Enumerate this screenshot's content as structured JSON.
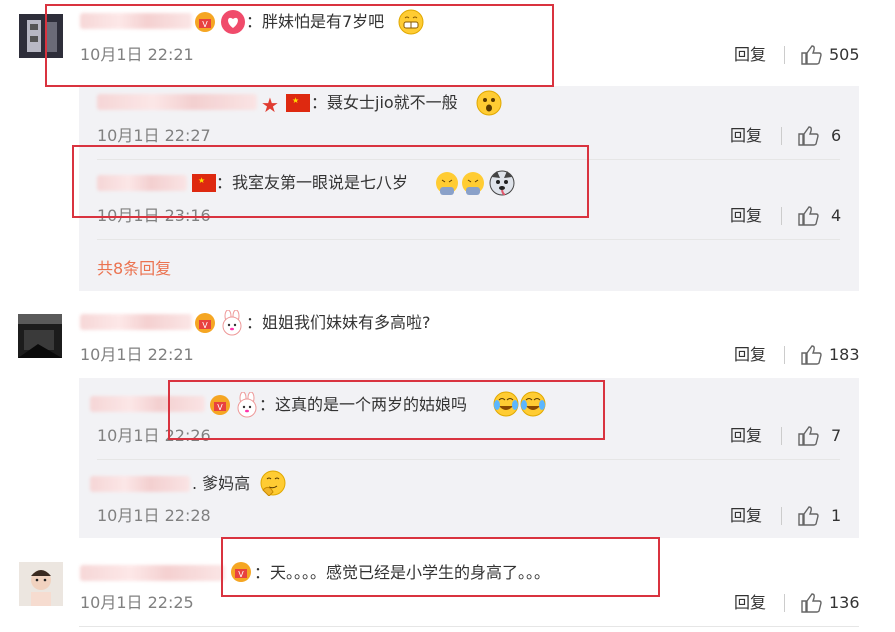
{
  "colors": {
    "redbox": "#d9333f",
    "more_link": "#eb7350",
    "reply_bg": "#f2f2f5",
    "time": "#808080"
  },
  "comments": [
    {
      "text": "：胖妹怕是有7岁吧",
      "time": "10月1日 22:21",
      "reply_label": "回复",
      "likes": "505"
    },
    {
      "text": "：姐姐我们妹妹有多高啦?",
      "time": "10月1日 22:21",
      "reply_label": "回复",
      "likes": "183"
    },
    {
      "text": "：天。。。。感觉已经是小学生的身高了。。。",
      "time": "10月1日 22:25",
      "reply_label": "回复",
      "likes": "136"
    }
  ],
  "replies": [
    {
      "text": "：聂女士jio就不一般",
      "time": "10月1日 22:27",
      "reply_label": "回复",
      "likes": "6"
    },
    {
      "text": "：我室友第一眼说是七八岁",
      "time": "10月1日 23:16",
      "reply_label": "回复",
      "likes": "4"
    },
    {
      "text": "：这真的是一个两岁的姑娘吗",
      "time": "10月1日 22:26",
      "reply_label": "回复",
      "likes": "7"
    },
    {
      "text": ". 爹妈高",
      "time": "10月1日 22:28",
      "reply_label": "回复",
      "likes": "1"
    }
  ],
  "more_replies": "共8条回复"
}
